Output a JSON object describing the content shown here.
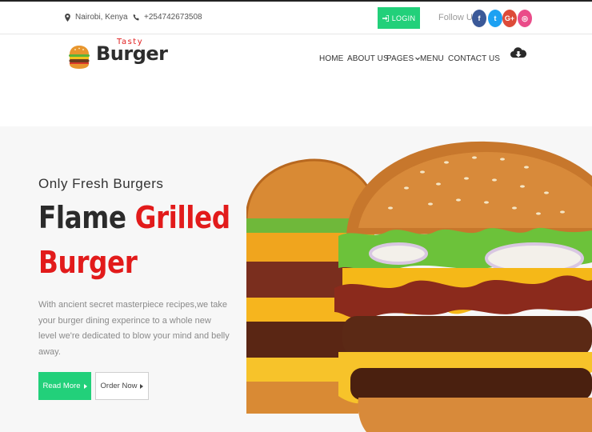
{
  "topbar": {
    "location": "Nairobi, Kenya",
    "phone": "+254742673508",
    "login_label": "LOGIN",
    "follow_label": "Follow Us:",
    "socials": [
      {
        "name": "facebook",
        "glyph": "f",
        "color": "#3b5998"
      },
      {
        "name": "twitter",
        "glyph": "t",
        "color": "#1da1f2"
      },
      {
        "name": "google-plus",
        "glyph": "G+",
        "color": "#dd4b39"
      },
      {
        "name": "dribbble",
        "glyph": "◎",
        "color": "#ea4c89"
      }
    ]
  },
  "logo": {
    "small": "Tasty",
    "main": "Burger"
  },
  "nav": {
    "home": "HOME",
    "about": "ABOUT US",
    "pages": "PAGES",
    "menu": "MENU",
    "contact": "CONTACT US"
  },
  "hero": {
    "tagline": "Only Fresh Burgers",
    "title_dark": "Flame",
    "title_red_1": "Grilled",
    "title_red_2": "Burger",
    "description": "With ancient secret masterpiece recipes,we take your burger dining experince to a whole new level we're dedicated to blow your mind and belly away.",
    "read_more": "Read More",
    "order_now": "Order Now"
  },
  "colors": {
    "accent_green": "#22d07a",
    "accent_red": "#e21b1b"
  }
}
